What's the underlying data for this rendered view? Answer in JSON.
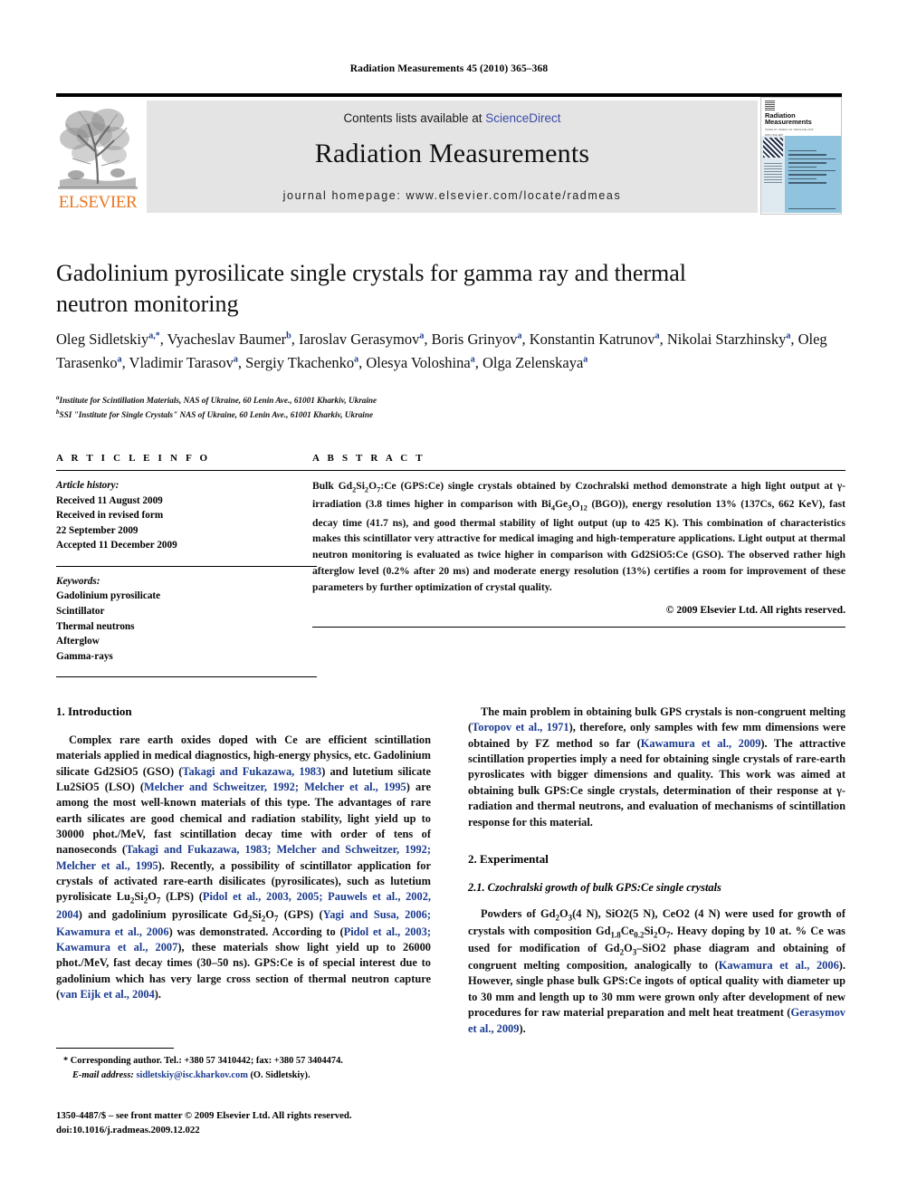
{
  "running_head": "Radiation Measurements 45 (2010) 365–368",
  "masthead": {
    "contents_prefix": "Contents lists available at ",
    "sciencedirect": "ScienceDirect",
    "journal_title": "Radiation Measurements",
    "homepage": "journal homepage: www.elsevier.com/locate/radmeas",
    "publisher_word": "ELSEVIER",
    "publisher_color": "#e87722",
    "link_color": "#3b4ba8",
    "banner_bg": "#e4e4e4",
    "cover": {
      "journal_name": "Radiation Measurements",
      "sub_line": "Volume 45 / Number 3-6 / March-June 2010",
      "issn_line": "ISSN 1350-4487"
    }
  },
  "article": {
    "title": "Gadolinium pyrosilicate single crystals for gamma ray and thermal neutron monitoring",
    "authors_html": "Oleg Sidletskiy<sup>a,*</sup>, Vyacheslav Baumer<sup>b</sup>, Iaroslav Gerasymov<sup>a</sup>, Boris Grinyov<sup>a</sup>, Konstantin Katrunov<sup>a</sup>, Nikolai Starzhinsky<sup>a</sup>, Oleg Tarasenko<sup>a</sup>, Vladimir Tarasov<sup>a</sup>, Sergiy Tkachenko<sup>a</sup>, Olesya Voloshina<sup>a</sup>, Olga Zelenskaya<sup>a</sup>",
    "affiliation_a": "Institute for Scintillation Materials, NAS of Ukraine, 60 Lenin Ave., 61001 Kharkiv, Ukraine",
    "affiliation_b": "SSI \"Institute for Single Crystals\" NAS of Ukraine, 60 Lenin Ave., 61001 Kharkiv, Ukraine"
  },
  "article_info": {
    "heading": "A R T I C L E    I N F O",
    "history_label": "Article history:",
    "history_lines": [
      "Received 11 August 2009",
      "Received in revised form",
      "22 September 2009",
      "Accepted 11 December 2009"
    ],
    "keywords_label": "Keywords:",
    "keywords": [
      "Gadolinium pyrosilicate",
      "Scintillator",
      "Thermal neutrons",
      "Afterglow",
      "Gamma-rays"
    ]
  },
  "abstract": {
    "heading": "A B S T R A C T",
    "text": "Bulk Gd2Si2O7:Ce (GPS:Ce) single crystals obtained by Czochralski method demonstrate a high light output at γ-irradiation (3.8 times higher in comparison with Bi4Ge3O12 (BGO)), energy resolution 13% (137Cs, 662 KeV), fast decay time (41.7 ns), and good thermal stability of light output (up to 425 K). This combination of characteristics makes this scintillator very attractive for medical imaging and high-temperature applications. Light output at thermal neutron monitoring is evaluated as twice higher in comparison with Gd2SiO5:Ce (GSO). The observed rather high afterglow level (0.2% after 20 ms) and moderate energy resolution (13%) certifies a room for improvement of these parameters by further optimization of crystal quality.",
    "copyright": "© 2009 Elsevier Ltd. All rights reserved."
  },
  "sections": {
    "introduction_heading": "1. Introduction",
    "introduction_p1": "Complex rare earth oxides doped with Ce are efficient scintillation materials applied in medical diagnostics, high-energy physics, etc. Gadolinium silicate Gd2SiO5 (GSO) (Takagi and Fukazawa, 1983) and lutetium silicate Lu2SiO5 (LSO) (Melcher and Schweitzer, 1992; Melcher et al., 1995) are among the most well-known materials of this type. The advantages of rare earth silicates are good chemical and radiation stability, light yield up to 30000 phot./MeV, fast scintillation decay time with order of tens of nanoseconds (Takagi and Fukazawa, 1983; Melcher and Schweitzer, 1992; Melcher et al., 1995). Recently, a possibility of scintillator application for crystals of activated rare-earth disilicates (pyrosilicates), such as lutetium pyrolisicate Lu2Si2O7 (LPS) (Pidol et al., 2003, 2005; Pauwels et al., 2002, 2004) and gadolinium pyrosilicate Gd2Si2O7 (GPS) (Yagi and Susa, 2006; Kawamura et al., 2006) was demonstrated. According to (Pidol et al., 2003; Kawamura et al., 2007), these materials show light yield up to 26000 phot./MeV, fast decay times (30–50 ns). GPS:Ce is of special interest due to gadolinium which has very large cross section of thermal neutron capture (van Eijk et al., 2004).",
    "right_p1": "The main problem in obtaining bulk GPS crystals is non-congruent melting (Toropov et al., 1971), therefore, only samples with few mm dimensions were obtained by FZ method so far (Kawamura et al., 2009). The attractive scintillation properties imply a need for obtaining single crystals of rare-earth pyroslicates with bigger dimensions and quality. This work was aimed at obtaining bulk GPS:Ce single crystals, determination of their response at γ-radiation and thermal neutrons, and evaluation of mechanisms of scintillation response for this material.",
    "experimental_heading": "2. Experimental",
    "experimental_sub_heading": "2.1. Czochralski growth of bulk GPS:Ce single crystals",
    "experimental_p1": "Powders of Gd2O3(4 N), SiO2(5 N), CeO2 (4 N) were used for growth of crystals with composition Gd1.8Ce0.2Si2O7. Heavy doping by 10 at. % Ce was used for modification of Gd2O3–SiO2 phase diagram and obtaining of congruent melting composition, analogically to (Kawamura et al., 2006). However, single phase bulk GPS:Ce ingots of optical quality with diameter up to 30 mm and length up to 30 mm were grown only after development of new procedures for raw material preparation and melt heat treatment (Gerasymov et al., 2009)."
  },
  "footnotes": {
    "corresponding": "* Corresponding author. Tel.: +380 57 3410442; fax: +380 57 3404474.",
    "email_label": "E-mail address:",
    "email": "sidletskiy@isc.kharkov.com",
    "email_suffix": "(O. Sidletskiy).",
    "issn_line1": "1350-4487/$ – see front matter © 2009 Elsevier Ltd. All rights reserved.",
    "issn_line2": "doi:10.1016/j.radmeas.2009.12.022"
  }
}
